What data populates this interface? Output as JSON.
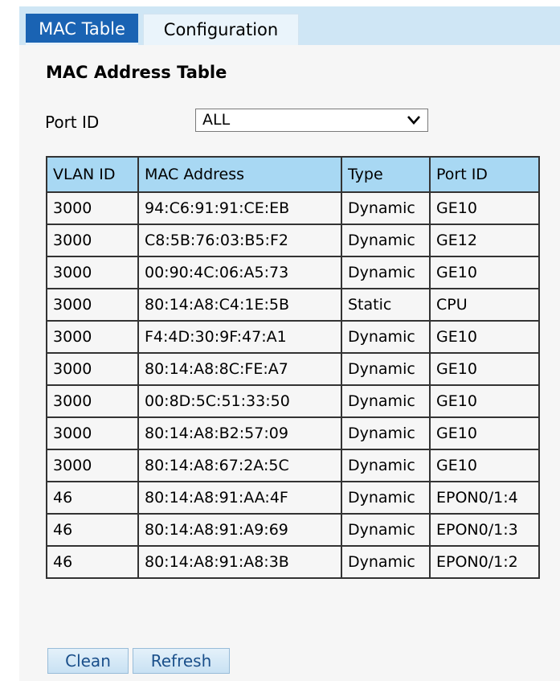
{
  "tabs": [
    {
      "label": "MAC Table",
      "active": true
    },
    {
      "label": "Configuration",
      "active": false
    }
  ],
  "page_title": "MAC Address Table",
  "filter": {
    "label": "Port ID",
    "selected": "ALL"
  },
  "table": {
    "headers": [
      "VLAN ID",
      "MAC Address",
      "Type",
      "Port ID"
    ],
    "rows": [
      [
        "3000",
        "94:C6:91:91:CE:EB",
        "Dynamic",
        "GE10"
      ],
      [
        "3000",
        "C8:5B:76:03:B5:F2",
        "Dynamic",
        "GE12"
      ],
      [
        "3000",
        "00:90:4C:06:A5:73",
        "Dynamic",
        "GE10"
      ],
      [
        "3000",
        "80:14:A8:C4:1E:5B",
        "Static",
        "CPU"
      ],
      [
        "3000",
        "F4:4D:30:9F:47:A1",
        "Dynamic",
        "GE10"
      ],
      [
        "3000",
        "80:14:A8:8C:FE:A7",
        "Dynamic",
        "GE10"
      ],
      [
        "3000",
        "00:8D:5C:51:33:50",
        "Dynamic",
        "GE10"
      ],
      [
        "3000",
        "80:14:A8:B2:57:09",
        "Dynamic",
        "GE10"
      ],
      [
        "3000",
        "80:14:A8:67:2A:5C",
        "Dynamic",
        "GE10"
      ],
      [
        "46",
        "80:14:A8:91:AA:4F",
        "Dynamic",
        "EPON0/1:4"
      ],
      [
        "46",
        "80:14:A8:91:A9:69",
        "Dynamic",
        "EPON0/1:3"
      ],
      [
        "46",
        "80:14:A8:91:A8:3B",
        "Dynamic",
        "EPON0/1:2"
      ]
    ]
  },
  "buttons": {
    "clean": "Clean",
    "refresh": "Refresh"
  },
  "colors": {
    "tab_active_bg": "#1a63b3",
    "tab_bar_bg": "#cfe6f5",
    "table_header_bg": "#a8d8f3"
  }
}
